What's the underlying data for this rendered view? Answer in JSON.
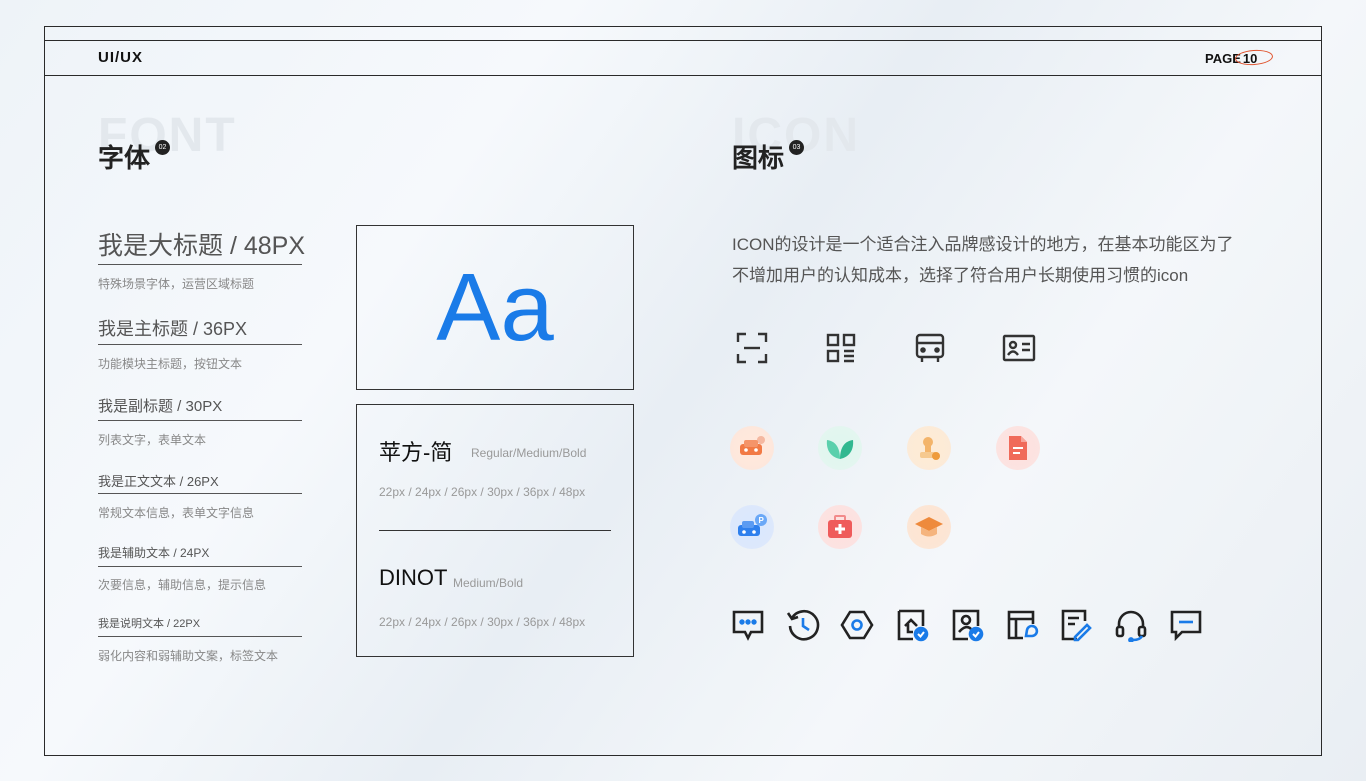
{
  "header": {
    "brand": "UI/UX",
    "page_label": "PAGE",
    "page_number": "10"
  },
  "font_section": {
    "ghost": "FONT",
    "title": "字体",
    "badge": "02",
    "rows": [
      {
        "label": "我是大标题 / 48PX",
        "desc": "特殊场景字体，运营区域标题"
      },
      {
        "label": "我是主标题 / 36PX",
        "desc": "功能模块主标题，按钮文本"
      },
      {
        "label": "我是副标题 / 30PX",
        "desc": "列表文字，表单文本"
      },
      {
        "label": "我是正文文本 / 26PX",
        "desc": "常规文本信息，表单文字信息"
      },
      {
        "label": "我是辅助文本 / 24PX",
        "desc": "次要信息，辅助信息，提示信息"
      },
      {
        "label": "我是说明文本 / 22PX",
        "desc": "弱化内容和弱辅助文案，标签文本"
      }
    ],
    "sample": "Aa",
    "fonts": [
      {
        "name": "苹方-简",
        "weights": "Regular/Medium/Bold",
        "sizes": "22px / 24px / 26px / 30px / 36px / 48px"
      },
      {
        "name": "DINOT",
        "weights": "Medium/Bold",
        "sizes": "22px / 24px / 26px / 30px / 36px / 48px"
      }
    ]
  },
  "icon_section": {
    "ghost": "ICON",
    "title": "图标",
    "badge": "03",
    "description": "ICON的设计是一个适合注入品牌感设计的地方，在基本功能区为了不增加用户的认知成本，选择了符合用户长期使用习惯的icon",
    "outline_icons": [
      "scan-icon",
      "qr-code-icon",
      "bus-icon",
      "id-card-icon"
    ],
    "color_icons": [
      "car-wash-icon",
      "leaf-icon",
      "stamp-icon",
      "document-icon",
      "parking-icon",
      "medical-kit-icon",
      "graduation-cap-icon"
    ],
    "line_icons": [
      "message-icon",
      "history-icon",
      "settings-hex-icon",
      "home-check-icon",
      "user-check-icon",
      "card-chat-icon",
      "edit-note-icon",
      "headset-icon",
      "comment-icon"
    ],
    "colors": {
      "accent": "#1a7be8",
      "ring": "#e0542f"
    }
  }
}
